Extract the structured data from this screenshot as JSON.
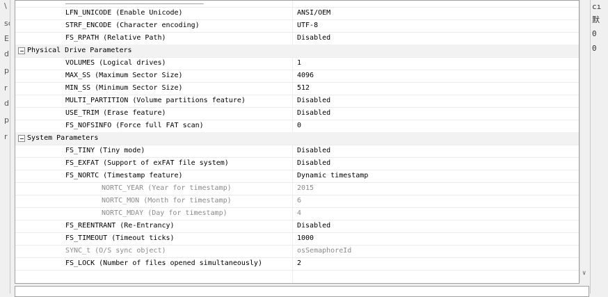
{
  "left_gutter": [
    "\\",
    "sc",
    "EI",
    "d",
    "p",
    "r",
    "d",
    "p",
    "r"
  ],
  "right_gutter": [
    "cı",
    "默",
    "0",
    "0"
  ],
  "rows": [
    {
      "name": "_________________________________",
      "value": "",
      "group": false,
      "grey": false
    },
    {
      "name": "LFN_UNICODE (Enable Unicode)",
      "value": "ANSI/OEM",
      "group": false,
      "grey": false
    },
    {
      "name": "STRF_ENCODE (Character encoding)",
      "value": "UTF-8",
      "group": false,
      "grey": false
    },
    {
      "name": "FS_RPATH (Relative Path)",
      "value": "Disabled",
      "group": false,
      "grey": false
    },
    {
      "name": "Physical Drive Parameters",
      "value": "",
      "group": true,
      "grey": false
    },
    {
      "name": "VOLUMES (Logical drives)",
      "value": "1",
      "group": false,
      "grey": false
    },
    {
      "name": "MAX_SS (Maximum Sector Size)",
      "value": "4096",
      "group": false,
      "grey": false
    },
    {
      "name": "MIN_SS (Minimum Sector Size)",
      "value": "512",
      "group": false,
      "grey": false
    },
    {
      "name": "MULTI_PARTITION (Volume partitions feature)",
      "value": "Disabled",
      "group": false,
      "grey": false
    },
    {
      "name": "USE_TRIM (Erase feature)",
      "value": "Disabled",
      "group": false,
      "grey": false
    },
    {
      "name": "FS_NOFSINFO (Force full FAT scan)",
      "value": "0",
      "group": false,
      "grey": false
    },
    {
      "name": "System Parameters",
      "value": "",
      "group": true,
      "grey": false
    },
    {
      "name": "FS_TINY (Tiny mode)",
      "value": "Disabled",
      "group": false,
      "grey": false
    },
    {
      "name": "FS_EXFAT (Support of exFAT file system)",
      "value": "Disabled",
      "group": false,
      "grey": false
    },
    {
      "name": "FS_NORTC (Timestamp feature)",
      "value": "Dynamic timestamp",
      "group": false,
      "grey": false
    },
    {
      "name": "NORTC_YEAR (Year for timestamp)",
      "value": "2015",
      "group": false,
      "grey": true,
      "sub": true
    },
    {
      "name": "NORTC_MON (Month for timestamp)",
      "value": "6",
      "group": false,
      "grey": true,
      "sub": true
    },
    {
      "name": "NORTC_MDAY (Day for timestamp)",
      "value": "4",
      "group": false,
      "grey": true,
      "sub": true
    },
    {
      "name": "FS_REENTRANT (Re-Entrancy)",
      "value": "Disabled",
      "group": false,
      "grey": false
    },
    {
      "name": "FS_TIMEOUT (Timeout ticks)",
      "value": "1000",
      "group": false,
      "grey": false
    },
    {
      "name": "SYNC_t (O/S sync object)",
      "value": "osSemaphoreId",
      "group": false,
      "grey": true
    },
    {
      "name": "FS_LOCK (Number of files opened simultaneously)",
      "value": "2",
      "group": false,
      "grey": false
    }
  ],
  "scroll_down_glyph": "∨",
  "colors": {
    "group_row_bg": "#f2f2f2",
    "grey_text": "#8a8a8a",
    "border": "#a0a0a0"
  }
}
